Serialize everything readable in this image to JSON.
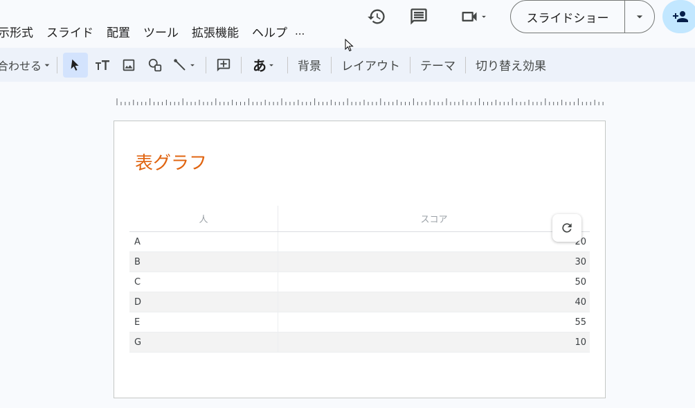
{
  "menu": {
    "items": [
      "示形式",
      "スライド",
      "配置",
      "ツール",
      "拡張機能",
      "ヘルプ"
    ],
    "more": "..."
  },
  "header": {
    "slideshow_label": "スライドショー"
  },
  "toolbar": {
    "zoom_label": "合わせる",
    "text_tools": [
      "背景",
      "レイアウト",
      "テーマ",
      "切り替え効果"
    ],
    "font_glyph": "あ"
  },
  "slide": {
    "title": "表グラフ",
    "table": {
      "headers": [
        "人",
        "スコア"
      ],
      "rows": [
        {
          "name": "A",
          "score": "20"
        },
        {
          "name": "B",
          "score": "30"
        },
        {
          "name": "C",
          "score": "50"
        },
        {
          "name": "D",
          "score": "40"
        },
        {
          "name": "E",
          "score": "55"
        },
        {
          "name": "G",
          "score": "10"
        }
      ]
    }
  },
  "colors": {
    "title": "#e06410",
    "accent": "#c2e7ff",
    "toolbar_bg": "#edf2fa"
  },
  "icons": {
    "history": "history-icon",
    "comment": "comment-icon",
    "meet": "video-camera-icon",
    "share": "person-add-icon",
    "refresh": "refresh-icon"
  }
}
